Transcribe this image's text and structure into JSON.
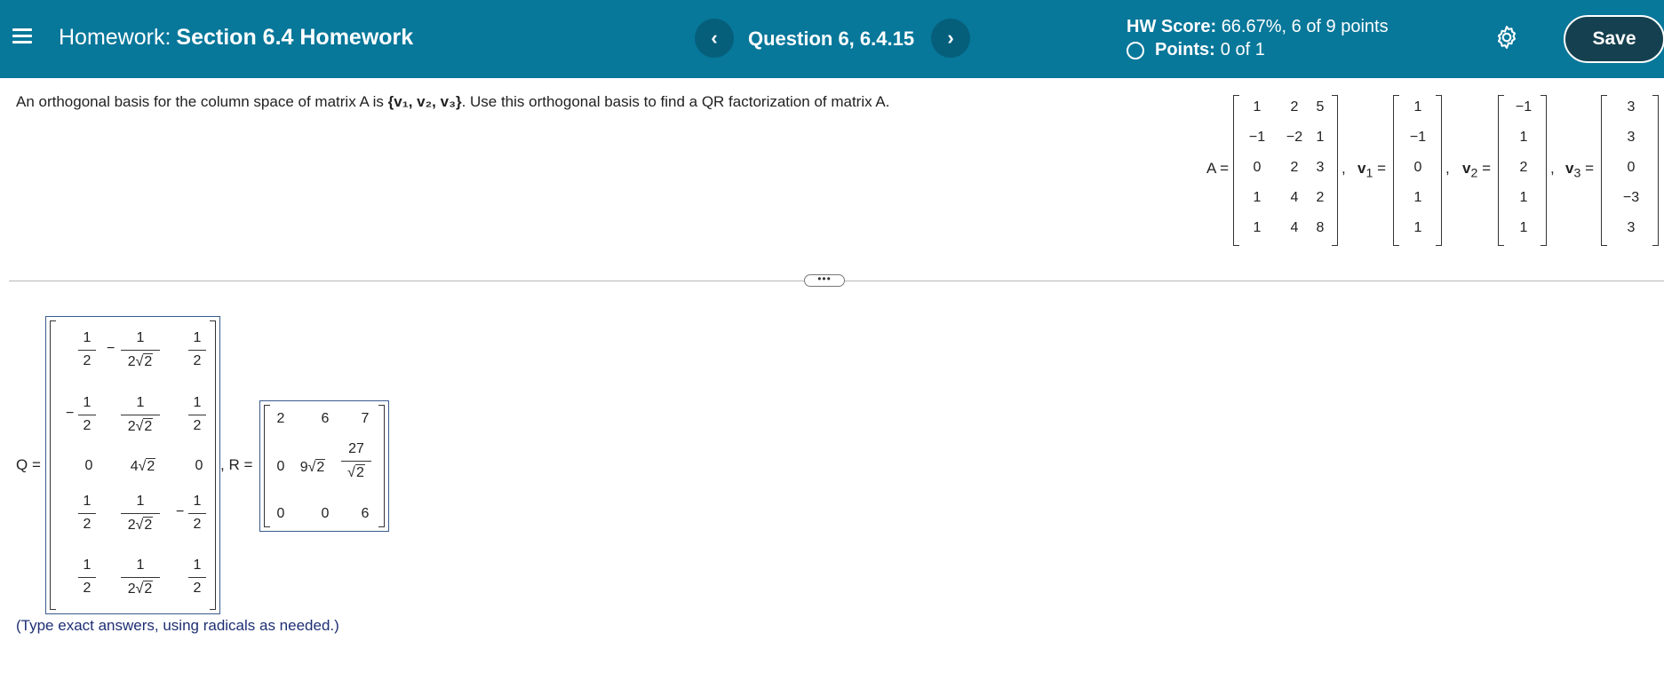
{
  "header": {
    "title_label": "Homework:",
    "title_value": "Section 6.4 Homework",
    "question_label": "Question 6, 6.4.15",
    "prev_glyph": "‹",
    "next_glyph": "›",
    "score_label": "HW Score:",
    "score_value": "66.67%, 6 of 9 points",
    "points_label": "Points:",
    "points_value": "0 of 1",
    "save_label": "Save",
    "color_bar": "#07779a"
  },
  "question": {
    "prefix": "An orthogonal basis for the column space of matrix A is",
    "basis": "{v₁, v₂, v₃}",
    "suffix": ". Use this orthogonal basis to find a QR factorization of matrix A."
  },
  "given": {
    "A_label": "A =",
    "A": [
      [
        "1",
        "2",
        "5"
      ],
      [
        "−1",
        "−2",
        "1"
      ],
      [
        "0",
        "2",
        "3"
      ],
      [
        "1",
        "4",
        "2"
      ],
      [
        "1",
        "4",
        "8"
      ]
    ],
    "v1_label": "v",
    "v1_sub": "1",
    "v1": [
      "1",
      "−1",
      "0",
      "1",
      "1"
    ],
    "v2_label": "v",
    "v2_sub": "2",
    "v2": [
      "−1",
      "1",
      "2",
      "1",
      "1"
    ],
    "v3_label": "v",
    "v3_sub": "3",
    "v3": [
      "3",
      "3",
      "0",
      "−3",
      "3"
    ],
    "eq": "=",
    "comma": ","
  },
  "answer": {
    "Q_label": "Q =",
    "R_label": ", R =",
    "Q": {
      "c1": [
        {
          "n": "1",
          "d": "2"
        },
        {
          "n": "1",
          "d": "2"
        },
        "0",
        {
          "n": "1",
          "d": "2"
        },
        {
          "n": "1",
          "d": "2"
        }
      ],
      "c2_num": [
        "1",
        "1",
        "",
        "1",
        "1"
      ],
      "c2_den_coef": [
        "2",
        "2",
        "",
        "2",
        "2"
      ],
      "c2_mid": "4",
      "radicand": "2",
      "c3": [
        {
          "n": "1",
          "d": "2"
        },
        {
          "n": "1",
          "d": "2"
        },
        "0",
        {
          "n": "1",
          "d": "2"
        },
        {
          "n": "1",
          "d": "2"
        }
      ]
    },
    "R": {
      "row1": [
        "2",
        "6",
        "7"
      ],
      "row2_c1": "0",
      "row2_c2_coef": "9",
      "row2_c3_num": "27",
      "row3": [
        "0",
        "0",
        "6"
      ]
    },
    "hint": "(Type exact answers, using radicals as needed.)"
  }
}
